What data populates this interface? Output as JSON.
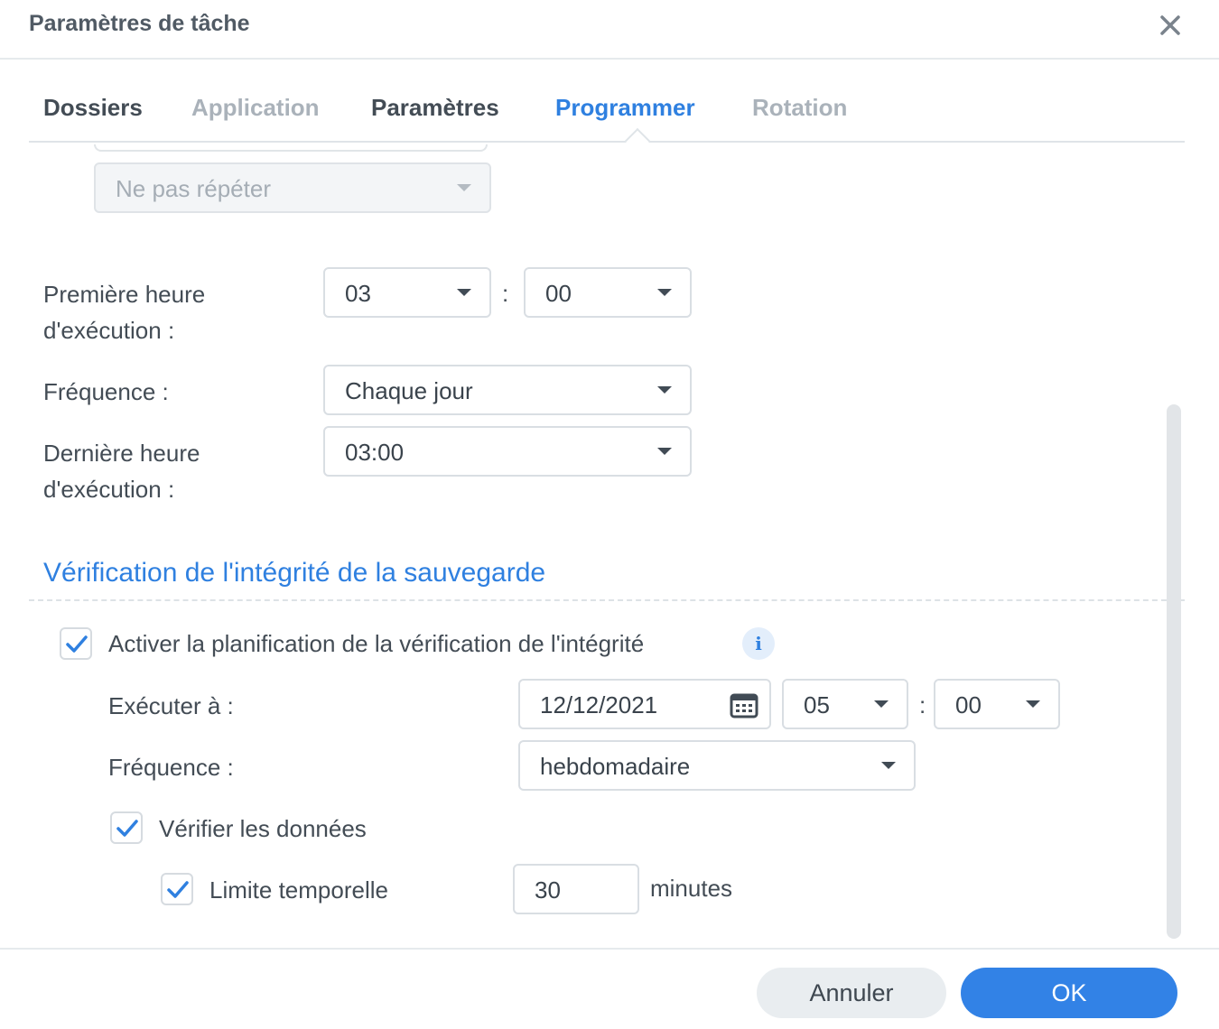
{
  "dialog": {
    "title": "Paramètres de tâche"
  },
  "tabs": [
    {
      "label": "Dossiers",
      "state": "normal"
    },
    {
      "label": "Application",
      "state": "disabled"
    },
    {
      "label": "Paramètres",
      "state": "normal"
    },
    {
      "label": "Programmer",
      "state": "active"
    },
    {
      "label": "Rotation",
      "state": "disabled"
    }
  ],
  "schedule": {
    "repeat": "Ne pas répéter",
    "first_run_label_1": "Première heure",
    "first_run_label_2": "d'exécution :",
    "first_run_hour": "03",
    "first_run_minute": "00",
    "time_separator": ":",
    "frequency_label": "Fréquence :",
    "frequency_value": "Chaque jour",
    "last_run_label_1": "Dernière heure",
    "last_run_label_2": "d'exécution :",
    "last_run_value": "03:00"
  },
  "integrity": {
    "section_title": "Vérification de l'intégrité de la sauvegarde",
    "enable_label": "Activer la planification de la vérification de l'intégrité",
    "enable_checked": true,
    "info_icon": "i",
    "run_at_label": "Exécuter à :",
    "run_date": "12/12/2021",
    "run_hour": "05",
    "run_minute": "00",
    "frequency_label": "Fréquence :",
    "frequency_value": "hebdomadaire",
    "verify_data_label": "Vérifier les données",
    "verify_data_checked": true,
    "time_limit_label": "Limite temporelle",
    "time_limit_checked": true,
    "time_limit_value": "30",
    "time_limit_unit": "minutes"
  },
  "footer": {
    "cancel_label": "Annuler",
    "ok_label": "OK"
  },
  "colors": {
    "accent": "#2f80e0",
    "ok_button": "#3282e6"
  }
}
